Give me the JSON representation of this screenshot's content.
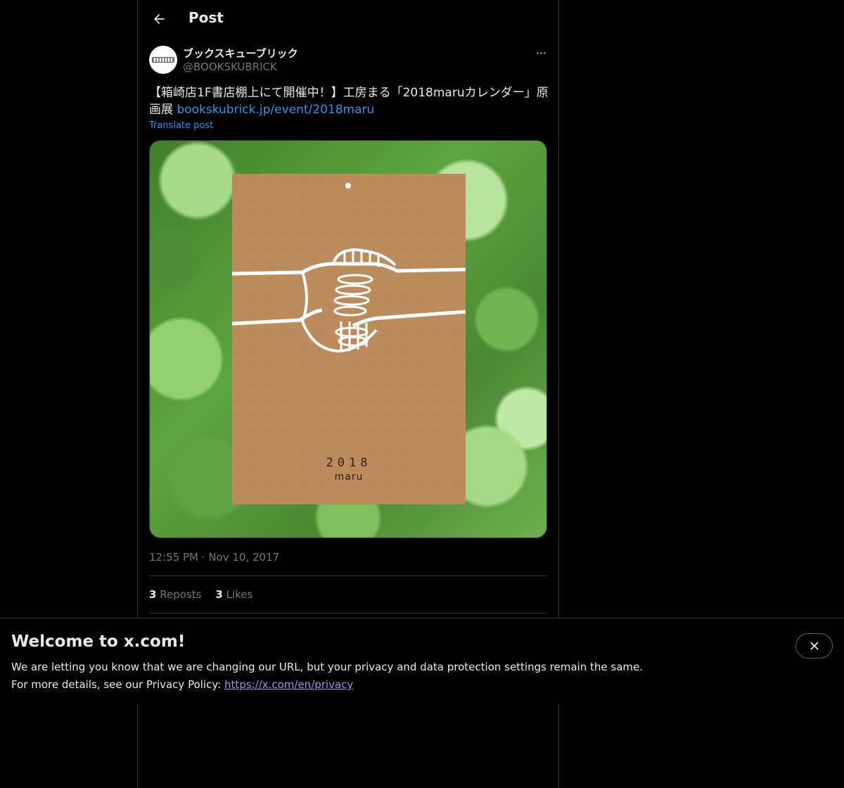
{
  "header": {
    "title": "Post"
  },
  "post": {
    "author": {
      "display_name": "ブックスキューブリック",
      "handle": "@BOOKSKUBRICK"
    },
    "text": "【箱崎店1F書店棚上にて開催中！】工房まる「2018maruカレンダー」原画展 ",
    "link_text": "bookskubrick.jp/event/2018maru",
    "translate_label": "Translate post",
    "media": {
      "card_year": "2018",
      "card_brand": "maru"
    },
    "time": "12:55 PM",
    "separator": "·",
    "date": "Nov 10, 2017",
    "stats": {
      "reposts_count": "3",
      "reposts_label": "Reposts",
      "likes_count": "3",
      "likes_label": "Likes"
    }
  },
  "banner": {
    "title": "Welcome to x.com!",
    "line1": "We are letting you know that we are changing our URL, but your privacy and data protection settings remain the same.",
    "line2_prefix": "For more details, see our Privacy Policy: ",
    "privacy_link": "https://x.com/en/privacy"
  },
  "colors": {
    "background": "#000000",
    "text": "#e7e9ea",
    "secondary": "#71767b",
    "accent": "#1d9bf0",
    "border": "#2f3336"
  }
}
